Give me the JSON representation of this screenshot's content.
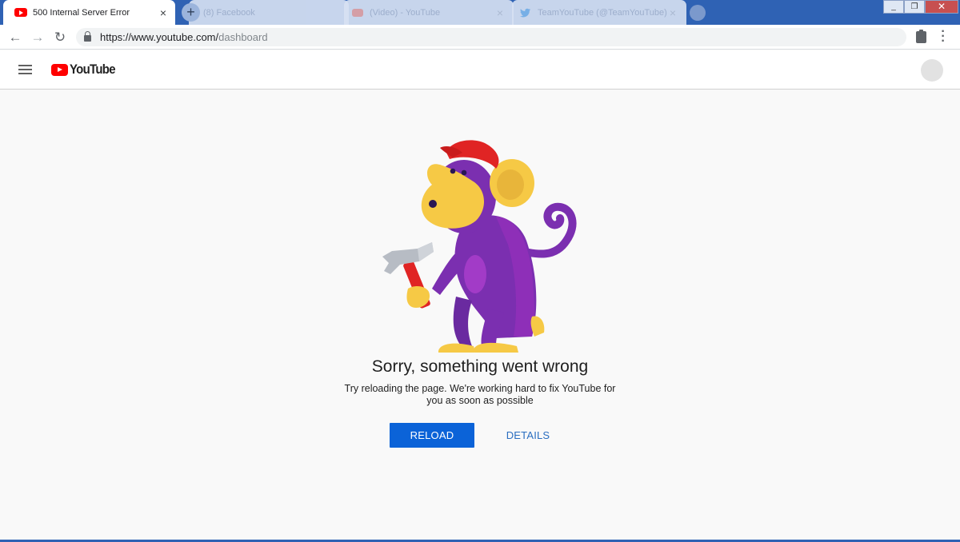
{
  "browser": {
    "tabs": [
      {
        "title": "500 Internal Server Error",
        "active": true,
        "icon": "youtube-favicon"
      },
      {
        "title": "(8) Facebook",
        "active": false,
        "icon": "generic-favicon"
      },
      {
        "title": "(Video) - YouTube",
        "active": false,
        "icon": "youtube-favicon"
      },
      {
        "title": "TeamYouTube (@TeamYouTube) /",
        "active": false,
        "icon": "twitter-favicon"
      }
    ],
    "new_tab_label": "+",
    "tab_close_glyph": "×",
    "window_controls": {
      "minimize": "_",
      "maximize": "❐",
      "close": "✕"
    },
    "address": {
      "host": "https://www.youtube.com/",
      "path": "dashboard"
    },
    "nav_icons": {
      "back": "←",
      "forward": "→",
      "reload": "↻"
    },
    "menu_glyph": "⋮"
  },
  "masthead": {
    "logo_text": "YouTube",
    "brand_color": "#ff0000"
  },
  "error": {
    "title": "Sorry, something went wrong",
    "message": "Try reloading the page. We're working hard to fix YouTube for you as soon as possible",
    "reload_label": "RELOAD",
    "details_label": "DETAILS",
    "illustration": "monkey-with-hammer"
  },
  "colors": {
    "tabstrip": "#2f62b4",
    "page_bg": "#f9f9f9",
    "primary_button": "#0b63d8",
    "link": "#2a6ec0",
    "monkey_purple": "#7b2fb0",
    "monkey_yellow": "#f6c945",
    "cap_red": "#e02424"
  }
}
